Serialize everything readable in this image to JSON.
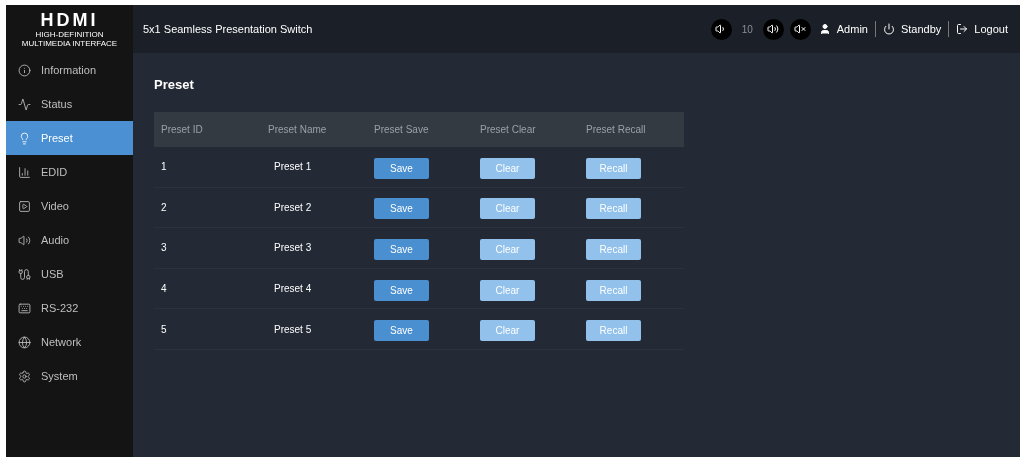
{
  "logo": {
    "text": "HDMI",
    "tagline": "HIGH-DEFINITION MULTIMEDIA INTERFACE"
  },
  "header": {
    "title": "5x1 Seamless Presentation Switch",
    "volume": "10",
    "user": "Admin",
    "standby": "Standby",
    "logout": "Logout"
  },
  "sidebar": {
    "items": [
      {
        "label": "Information",
        "selected": false
      },
      {
        "label": "Status",
        "selected": false
      },
      {
        "label": "Preset",
        "selected": true
      },
      {
        "label": "EDID",
        "selected": false
      },
      {
        "label": "Video",
        "selected": false
      },
      {
        "label": "Audio",
        "selected": false
      },
      {
        "label": "USB",
        "selected": false
      },
      {
        "label": "RS-232",
        "selected": false
      },
      {
        "label": "Network",
        "selected": false
      },
      {
        "label": "System",
        "selected": false
      }
    ]
  },
  "page_title": "Preset",
  "table": {
    "columns": [
      "Preset ID",
      "Preset Name",
      "Preset Save",
      "Preset Clear",
      "Preset Recall"
    ],
    "rows": [
      {
        "id": "1",
        "name": "Preset 1",
        "buttons": [
          {
            "label": "Save",
            "disabled": false
          },
          {
            "label": "Clear",
            "disabled": true
          },
          {
            "label": "Recall",
            "disabled": true
          }
        ]
      },
      {
        "id": "2",
        "name": "Preset 2",
        "buttons": [
          {
            "label": "Save",
            "disabled": false
          },
          {
            "label": "Clear",
            "disabled": true
          },
          {
            "label": "Recall",
            "disabled": true
          }
        ]
      },
      {
        "id": "3",
        "name": "Preset 3",
        "buttons": [
          {
            "label": "Save",
            "disabled": false
          },
          {
            "label": "Clear",
            "disabled": true
          },
          {
            "label": "Recall",
            "disabled": true
          }
        ]
      },
      {
        "id": "4",
        "name": "Preset 4",
        "buttons": [
          {
            "label": "Save",
            "disabled": false
          },
          {
            "label": "Clear",
            "disabled": true
          },
          {
            "label": "Recall",
            "disabled": true
          }
        ]
      },
      {
        "id": "5",
        "name": "Preset 5",
        "buttons": [
          {
            "label": "Save",
            "disabled": false
          },
          {
            "label": "Clear",
            "disabled": true
          },
          {
            "label": "Recall",
            "disabled": true
          }
        ]
      }
    ]
  }
}
